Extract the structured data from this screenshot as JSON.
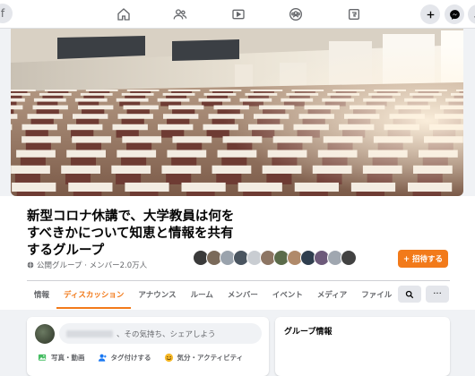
{
  "topnav": {
    "icons": [
      "home-icon",
      "friends-icon",
      "watch-icon",
      "groups-icon",
      "gaming-icon",
      "add-icon",
      "messenger-icon",
      "notifications-icon"
    ]
  },
  "group": {
    "title": "新型コロナ休講で、大学教員は何をすべきかについて知恵と情報を共有するグループ",
    "meta": "公開グループ · メンバー2.0万人",
    "invite_label": "+ 招待する"
  },
  "tabs": [
    {
      "label": "情報",
      "active": false
    },
    {
      "label": "ディスカッション",
      "active": true
    },
    {
      "label": "アナウンス",
      "active": false
    },
    {
      "label": "ルーム",
      "active": false
    },
    {
      "label": "メンバー",
      "active": false
    },
    {
      "label": "イベント",
      "active": false
    },
    {
      "label": "メディア",
      "active": false
    },
    {
      "label": "ファイル",
      "active": false
    }
  ],
  "composer": {
    "placeholder": "、その気持ち、シェアしよう",
    "actions": {
      "photo": "写真・動画",
      "tag": "タグ付けする",
      "feeling": "気分・アクティビティ"
    }
  },
  "sidebar": {
    "info_title": "グループ情報"
  },
  "colors": {
    "accent": "#f27a1a",
    "photo_icon": "#45bd62",
    "tag_icon": "#1877f2",
    "feeling_icon": "#f7b928"
  },
  "member_avatars": [
    "#3a3a3a",
    "#7a6a5a",
    "#9aa3ad",
    "#4a5560",
    "#c9cdd2",
    "#8d7563",
    "#5b6b4a",
    "#b08a6a",
    "#2f3e4e",
    "#6d5a7a",
    "#a0a7b0",
    "#424242"
  ]
}
